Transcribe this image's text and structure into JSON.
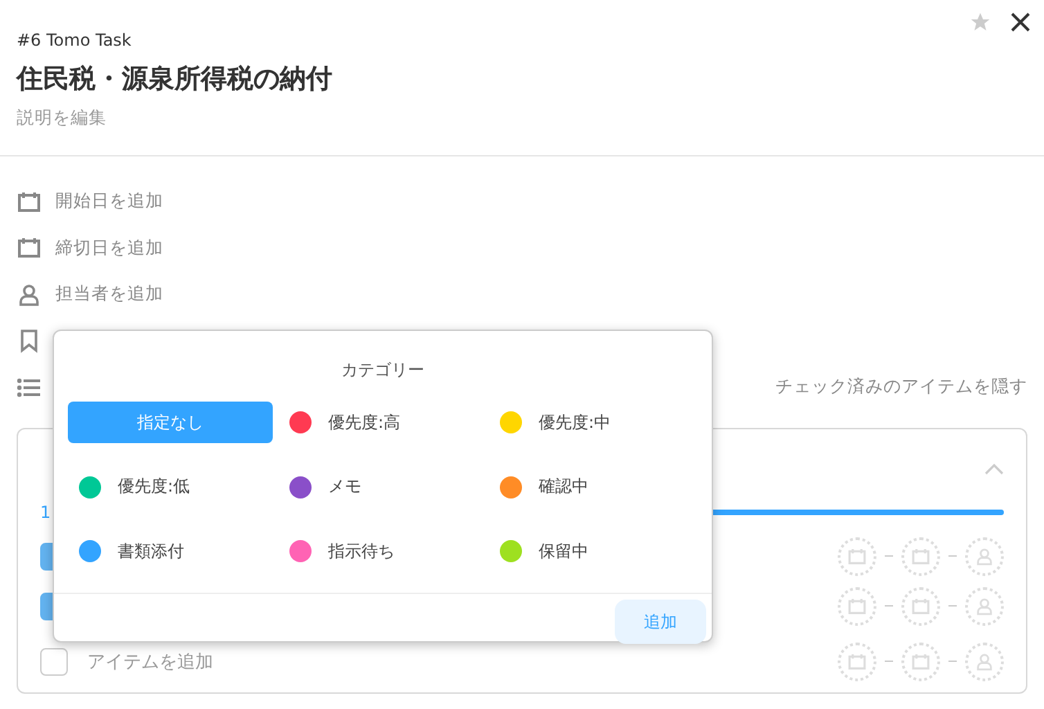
{
  "header": {
    "project": "#6 Tomo Task",
    "title": "住民税・源泉所得税の納付",
    "description": "説明を編集",
    "starred": false
  },
  "fields": [
    {
      "kind": "calendar",
      "label": "開始日を追加"
    },
    {
      "kind": "calendar",
      "label": "締切日を追加"
    },
    {
      "kind": "person",
      "label": "担当者を追加"
    },
    {
      "kind": "bookmark"
    },
    {
      "kind": "list",
      "action": "チェック済みのアイテムを隠す"
    }
  ],
  "checklist": {
    "progress": "1",
    "level": 1,
    "expanded": true,
    "items": [
      {
        "checked": true
      },
      {
        "checked": true
      },
      {
        "checked": false,
        "placeholder": "アイテムを追加"
      }
    ]
  },
  "category_popup": {
    "title": "カテゴリー",
    "options": [
      {
        "label": "指定なし",
        "selected": true
      },
      {
        "label": "優先度:高",
        "color": "#ff3a52",
        "selected": false
      },
      {
        "label": "優先度:中",
        "color": "#ffd600",
        "selected": false
      },
      {
        "label": "優先度:低",
        "color": "#00c896",
        "selected": false
      },
      {
        "label": "メモ",
        "color": "#8a4fc9",
        "selected": false
      },
      {
        "label": "確認中",
        "color": "#ff8c26",
        "selected": false
      },
      {
        "label": "書類添付",
        "color": "#33a4ff",
        "selected": false
      },
      {
        "label": "指示待ち",
        "color": "#ff63b4",
        "selected": false
      },
      {
        "label": "保留中",
        "color": "#9ee020",
        "selected": false
      }
    ],
    "button": "追加"
  }
}
